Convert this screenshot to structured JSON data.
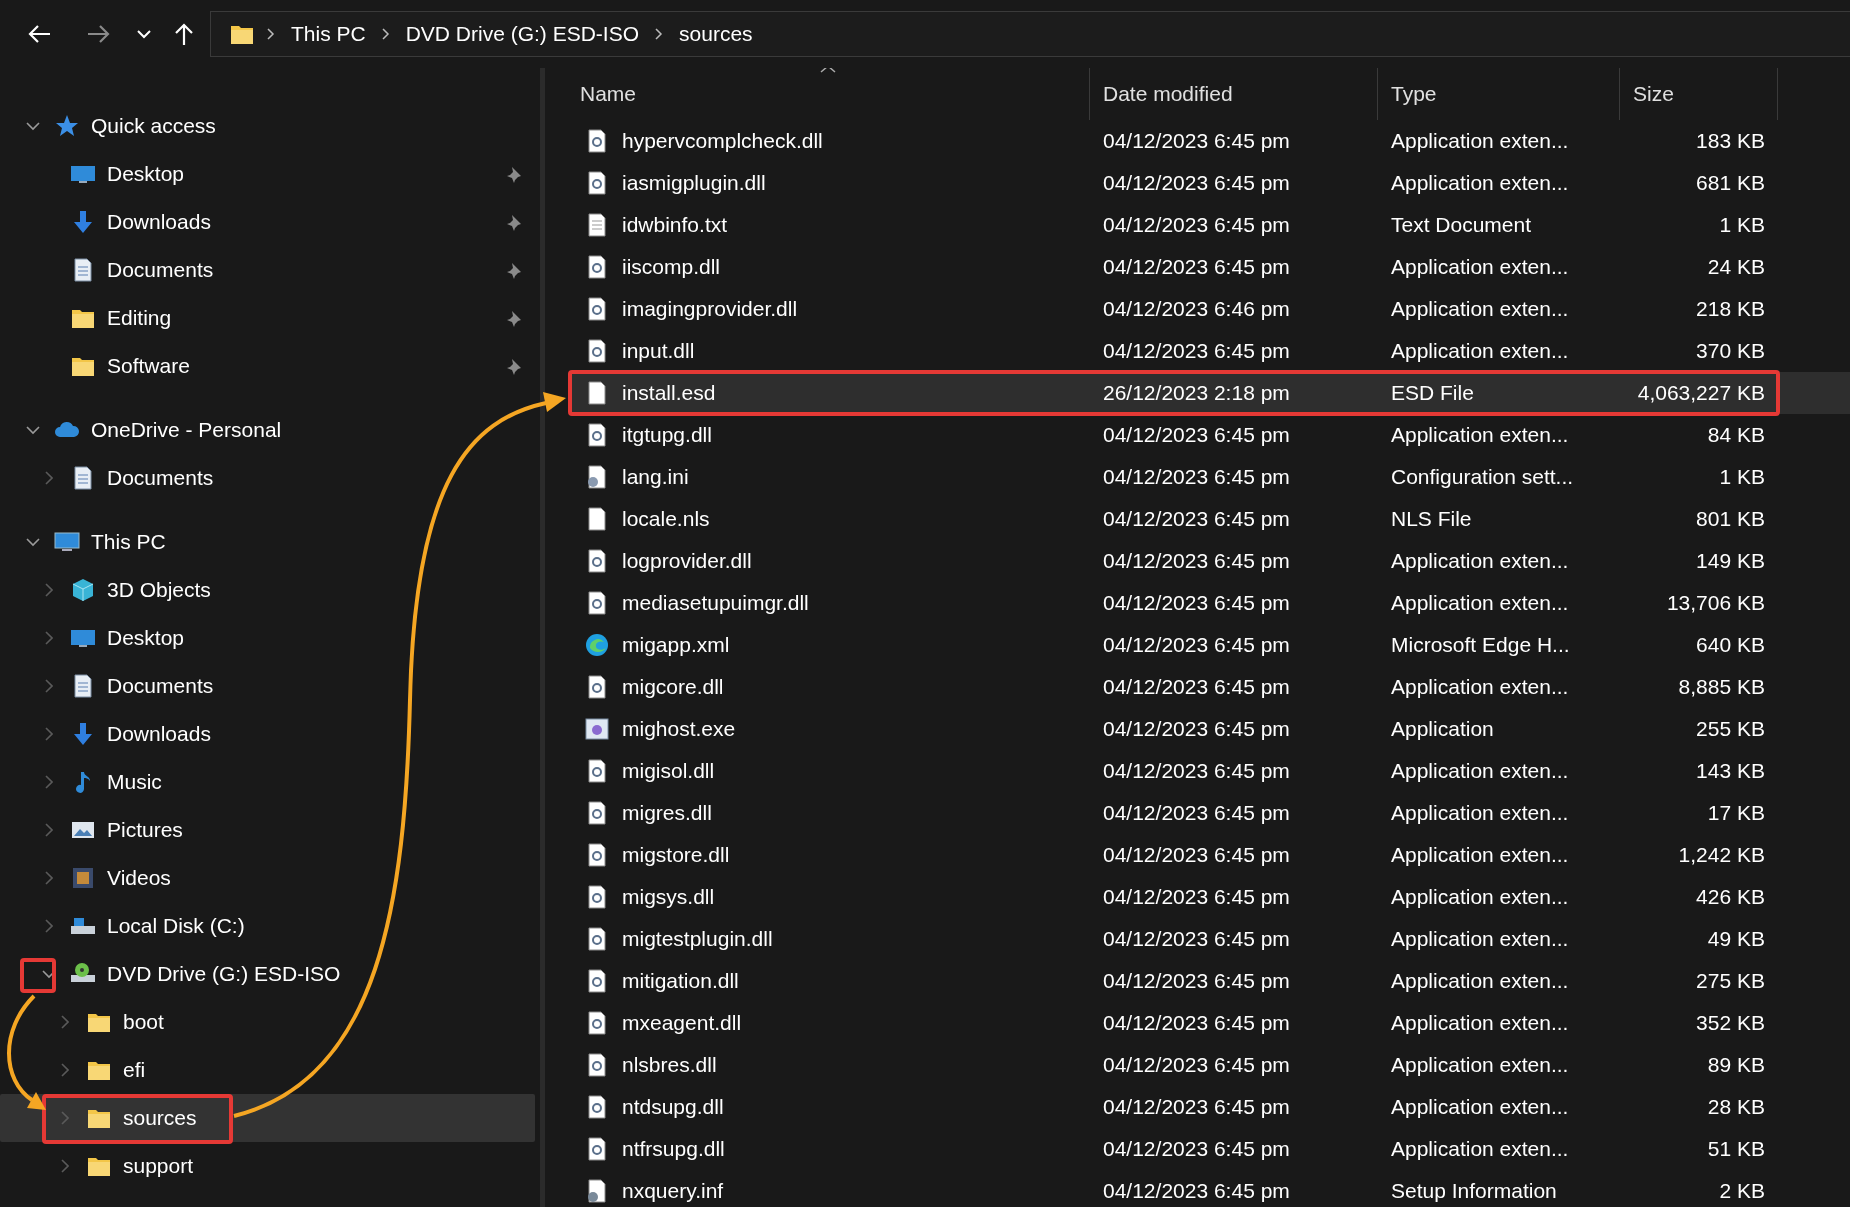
{
  "address_bar": {
    "path": [
      "This PC",
      "DVD Drive (G:) ESD-ISO",
      "sources"
    ]
  },
  "sidebar": {
    "sections": [
      {
        "label": "Quick access",
        "kind": "star",
        "expanded": true,
        "selected": false,
        "highlighted": false,
        "chevron_highlighted": false,
        "children": [
          {
            "label": "Desktop",
            "kind": "desktop",
            "pinned": true,
            "selected": false,
            "highlighted": false,
            "chevron_highlighted": false
          },
          {
            "label": "Downloads",
            "kind": "download",
            "pinned": true,
            "selected": false,
            "highlighted": false,
            "chevron_highlighted": false
          },
          {
            "label": "Documents",
            "kind": "document",
            "pinned": true,
            "selected": false,
            "highlighted": false,
            "chevron_highlighted": false
          },
          {
            "label": "Editing",
            "kind": "folder",
            "pinned": true,
            "selected": false,
            "highlighted": false,
            "chevron_highlighted": false
          },
          {
            "label": "Software",
            "kind": "folder",
            "pinned": true,
            "selected": false,
            "highlighted": false,
            "chevron_highlighted": false
          }
        ]
      },
      {
        "label": "OneDrive - Personal",
        "kind": "cloud",
        "expanded": true,
        "selected": false,
        "highlighted": false,
        "chevron_highlighted": false,
        "children": [
          {
            "label": "Documents",
            "kind": "document",
            "expanded": false,
            "selected": false,
            "highlighted": false,
            "chevron_highlighted": false
          }
        ]
      },
      {
        "label": "This PC",
        "kind": "pc",
        "expanded": true,
        "selected": false,
        "highlighted": false,
        "chevron_highlighted": false,
        "children": [
          {
            "label": "3D Objects",
            "kind": "cube",
            "expanded": false,
            "selected": false,
            "highlighted": false,
            "chevron_highlighted": false
          },
          {
            "label": "Desktop",
            "kind": "desktop",
            "expanded": false,
            "selected": false,
            "highlighted": false,
            "chevron_highlighted": false
          },
          {
            "label": "Documents",
            "kind": "document",
            "expanded": false,
            "selected": false,
            "highlighted": false,
            "chevron_highlighted": false
          },
          {
            "label": "Downloads",
            "kind": "download",
            "expanded": false,
            "selected": false,
            "highlighted": false,
            "chevron_highlighted": false
          },
          {
            "label": "Music",
            "kind": "music",
            "expanded": false,
            "selected": false,
            "highlighted": false,
            "chevron_highlighted": false
          },
          {
            "label": "Pictures",
            "kind": "pictures",
            "expanded": false,
            "selected": false,
            "highlighted": false,
            "chevron_highlighted": false
          },
          {
            "label": "Videos",
            "kind": "videos",
            "expanded": false,
            "selected": false,
            "highlighted": false,
            "chevron_highlighted": false
          },
          {
            "label": "Local Disk (C:)",
            "kind": "disk",
            "expanded": false,
            "selected": false,
            "highlighted": false,
            "chevron_highlighted": false
          },
          {
            "label": "DVD Drive (G:) ESD-ISO",
            "kind": "dvd",
            "expanded": true,
            "selected": false,
            "highlighted": false,
            "chevron_highlighted": true,
            "children": [
              {
                "label": "boot",
                "kind": "folder",
                "expanded": false,
                "selected": false,
                "highlighted": false,
                "chevron_highlighted": false
              },
              {
                "label": "efi",
                "kind": "folder",
                "expanded": false,
                "selected": false,
                "highlighted": false,
                "chevron_highlighted": false
              },
              {
                "label": "sources",
                "kind": "folder",
                "expanded": false,
                "selected": true,
                "highlighted": true,
                "chevron_highlighted": false
              },
              {
                "label": "support",
                "kind": "folder",
                "expanded": false,
                "selected": false,
                "highlighted": false,
                "chevron_highlighted": false
              }
            ]
          }
        ]
      }
    ]
  },
  "table": {
    "columns": [
      {
        "label": "Name",
        "sorted": true
      },
      {
        "label": "Date modified",
        "sorted": false
      },
      {
        "label": "Type",
        "sorted": false
      },
      {
        "label": "Size",
        "sorted": false
      }
    ],
    "rows": [
      {
        "name": "hypervcomplcheck.dll",
        "date": "04/12/2023 6:45 pm",
        "type": "Application exten...",
        "size": "183 KB",
        "kind": "dll",
        "selected": false,
        "highlighted": false
      },
      {
        "name": "iasmigplugin.dll",
        "date": "04/12/2023 6:45 pm",
        "type": "Application exten...",
        "size": "681 KB",
        "kind": "dll",
        "selected": false,
        "highlighted": false
      },
      {
        "name": "idwbinfo.txt",
        "date": "04/12/2023 6:45 pm",
        "type": "Text Document",
        "size": "1 KB",
        "kind": "txt",
        "selected": false,
        "highlighted": false
      },
      {
        "name": "iiscomp.dll",
        "date": "04/12/2023 6:45 pm",
        "type": "Application exten...",
        "size": "24 KB",
        "kind": "dll",
        "selected": false,
        "highlighted": false
      },
      {
        "name": "imagingprovider.dll",
        "date": "04/12/2023 6:46 pm",
        "type": "Application exten...",
        "size": "218 KB",
        "kind": "dll",
        "selected": false,
        "highlighted": false
      },
      {
        "name": "input.dll",
        "date": "04/12/2023 6:45 pm",
        "type": "Application exten...",
        "size": "370 KB",
        "kind": "dll",
        "selected": false,
        "highlighted": false
      },
      {
        "name": "install.esd",
        "date": "26/12/2023 2:18 pm",
        "type": "ESD File",
        "size": "4,063,227 KB",
        "kind": "blank",
        "selected": true,
        "highlighted": true
      },
      {
        "name": "itgtupg.dll",
        "date": "04/12/2023 6:45 pm",
        "type": "Application exten...",
        "size": "84 KB",
        "kind": "dll",
        "selected": false,
        "highlighted": false
      },
      {
        "name": "lang.ini",
        "date": "04/12/2023 6:45 pm",
        "type": "Configuration sett...",
        "size": "1 KB",
        "kind": "ini",
        "selected": false,
        "highlighted": false
      },
      {
        "name": "locale.nls",
        "date": "04/12/2023 6:45 pm",
        "type": "NLS File",
        "size": "801 KB",
        "kind": "blank",
        "selected": false,
        "highlighted": false
      },
      {
        "name": "logprovider.dll",
        "date": "04/12/2023 6:45 pm",
        "type": "Application exten...",
        "size": "149 KB",
        "kind": "dll",
        "selected": false,
        "highlighted": false
      },
      {
        "name": "mediasetupuimgr.dll",
        "date": "04/12/2023 6:45 pm",
        "type": "Application exten...",
        "size": "13,706 KB",
        "kind": "dll",
        "selected": false,
        "highlighted": false
      },
      {
        "name": "migapp.xml",
        "date": "04/12/2023 6:45 pm",
        "type": "Microsoft Edge H...",
        "size": "640 KB",
        "kind": "edge",
        "selected": false,
        "highlighted": false
      },
      {
        "name": "migcore.dll",
        "date": "04/12/2023 6:45 pm",
        "type": "Application exten...",
        "size": "8,885 KB",
        "kind": "dll",
        "selected": false,
        "highlighted": false
      },
      {
        "name": "mighost.exe",
        "date": "04/12/2023 6:45 pm",
        "type": "Application",
        "size": "255 KB",
        "kind": "exe",
        "selected": false,
        "highlighted": false
      },
      {
        "name": "migisol.dll",
        "date": "04/12/2023 6:45 pm",
        "type": "Application exten...",
        "size": "143 KB",
        "kind": "dll",
        "selected": false,
        "highlighted": false
      },
      {
        "name": "migres.dll",
        "date": "04/12/2023 6:45 pm",
        "type": "Application exten...",
        "size": "17 KB",
        "kind": "dll",
        "selected": false,
        "highlighted": false
      },
      {
        "name": "migstore.dll",
        "date": "04/12/2023 6:45 pm",
        "type": "Application exten...",
        "size": "1,242 KB",
        "kind": "dll",
        "selected": false,
        "highlighted": false
      },
      {
        "name": "migsys.dll",
        "date": "04/12/2023 6:45 pm",
        "type": "Application exten...",
        "size": "426 KB",
        "kind": "dll",
        "selected": false,
        "highlighted": false
      },
      {
        "name": "migtestplugin.dll",
        "date": "04/12/2023 6:45 pm",
        "type": "Application exten...",
        "size": "49 KB",
        "kind": "dll",
        "selected": false,
        "highlighted": false
      },
      {
        "name": "mitigation.dll",
        "date": "04/12/2023 6:45 pm",
        "type": "Application exten...",
        "size": "275 KB",
        "kind": "dll",
        "selected": false,
        "highlighted": false
      },
      {
        "name": "mxeagent.dll",
        "date": "04/12/2023 6:45 pm",
        "type": "Application exten...",
        "size": "352 KB",
        "kind": "dll",
        "selected": false,
        "highlighted": false
      },
      {
        "name": "nlsbres.dll",
        "date": "04/12/2023 6:45 pm",
        "type": "Application exten...",
        "size": "89 KB",
        "kind": "dll",
        "selected": false,
        "highlighted": false
      },
      {
        "name": "ntdsupg.dll",
        "date": "04/12/2023 6:45 pm",
        "type": "Application exten...",
        "size": "28 KB",
        "kind": "dll",
        "selected": false,
        "highlighted": false
      },
      {
        "name": "ntfrsupg.dll",
        "date": "04/12/2023 6:45 pm",
        "type": "Application exten...",
        "size": "51 KB",
        "kind": "dll",
        "selected": false,
        "highlighted": false
      },
      {
        "name": "nxquery.inf",
        "date": "04/12/2023 6:45 pm",
        "type": "Setup Information",
        "size": "2 KB",
        "kind": "inf",
        "selected": false,
        "highlighted": false
      }
    ]
  }
}
